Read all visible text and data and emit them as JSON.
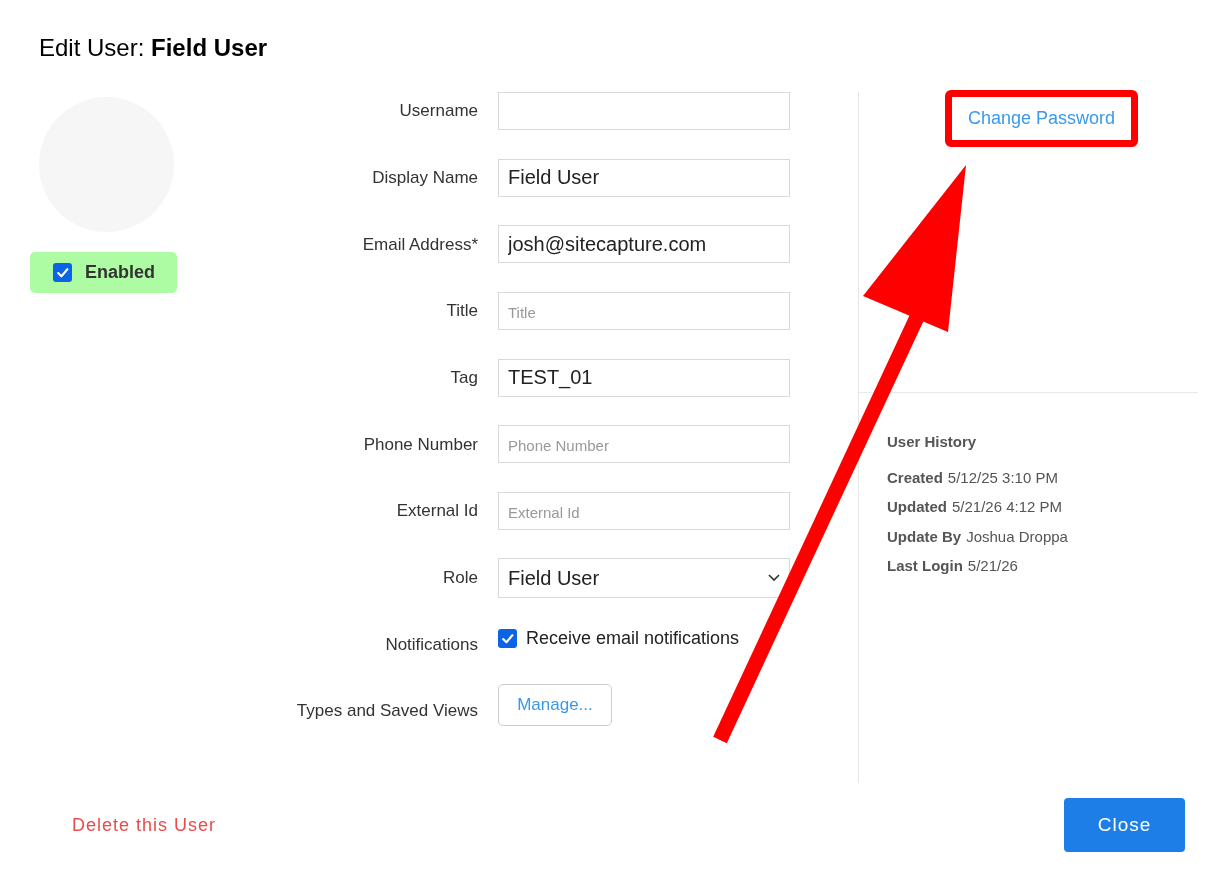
{
  "title": "Edit User: **Field User**",
  "enabled": {
    "label": "Enabled",
    "checked": true
  },
  "fields": [
    {
      "kind": "text",
      "label": "Username"
    },
    {
      "kind": "text",
      "label": "Display Name",
      "value": "Field User"
    },
    {
      "kind": "text",
      "label": "Email Address*",
      "value": "josh@sitecapture.com"
    },
    {
      "kind": "text",
      "label": "Title",
      "placeholder": "Title"
    },
    {
      "kind": "text",
      "label": "Tag",
      "value": "TEST_01"
    },
    {
      "kind": "text",
      "label": "Phone Number",
      "placeholder": "Phone Number"
    },
    {
      "kind": "text",
      "label": "External Id",
      "placeholder": "External Id"
    },
    {
      "kind": "select",
      "label": "Role",
      "value": "Field User"
    },
    {
      "kind": "checkbox",
      "label": "Notifications",
      "text": "Receive email notifications",
      "checked": true
    },
    {
      "kind": "button",
      "label": "Types and Saved Views",
      "text": "Manage..."
    }
  ],
  "change_password": "Change Password",
  "history": {
    "title": "User History",
    "rows": [
      {
        "label": "Created",
        "value": "5/12/25 3:10 PM"
      },
      {
        "label": "Updated",
        "value": "5/21/26 4:12 PM"
      },
      {
        "label": "Update By",
        "value": "Joshua Droppa"
      },
      {
        "label": "Last Login",
        "value": "5/21/26"
      }
    ]
  },
  "delete_link": "Delete this User",
  "close_button": "Close"
}
